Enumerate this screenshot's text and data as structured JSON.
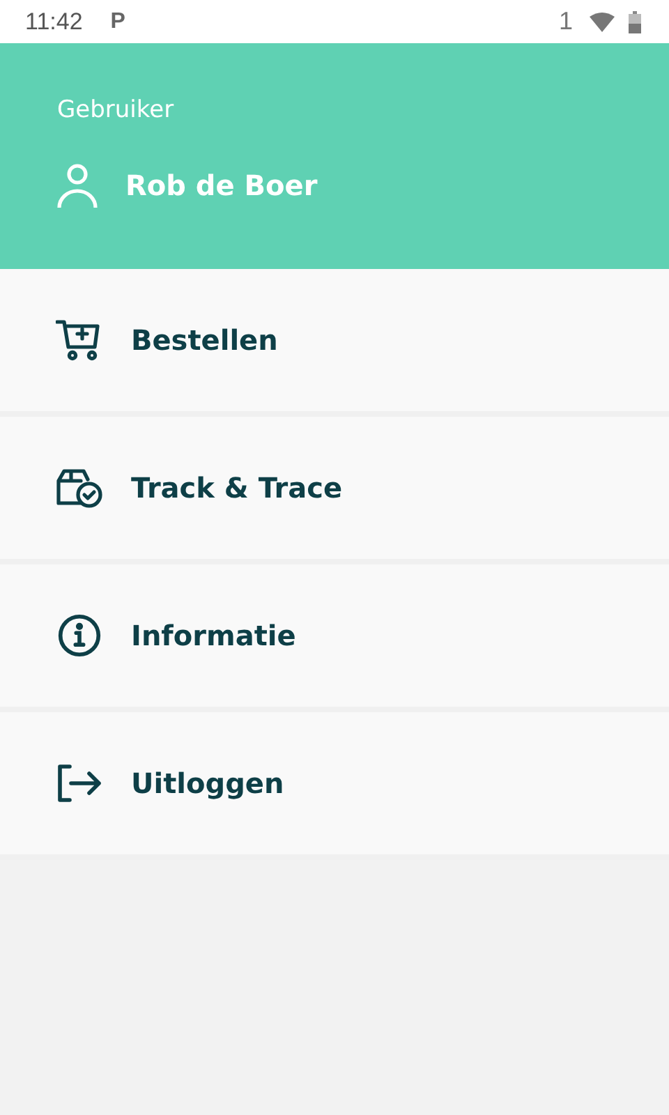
{
  "status_bar": {
    "time": "11:42",
    "notification": "P",
    "sim": "1"
  },
  "header": {
    "label": "Gebruiker",
    "user_name": "Rob de Boer"
  },
  "menu": [
    {
      "kind": "cart",
      "label": "Bestellen"
    },
    {
      "kind": "package",
      "label": "Track & Trace"
    },
    {
      "kind": "info",
      "label": "Informatie"
    },
    {
      "kind": "logout",
      "label": "Uitloggen"
    }
  ]
}
